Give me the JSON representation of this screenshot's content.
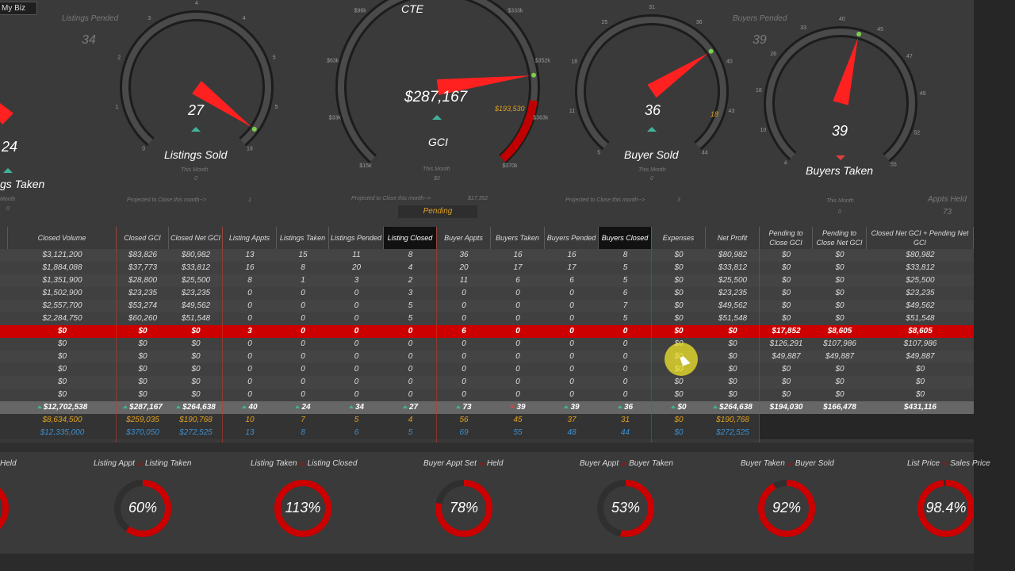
{
  "tab_label": "My Biz",
  "top_title": "CTE",
  "gauges": {
    "listings_taken": {
      "value": "24",
      "label": "gs Taken",
      "header_count": "34",
      "header_label": "Listings Pended",
      "ticks": [
        "5",
        "6",
        "7",
        "7",
        "7",
        "8"
      ]
    },
    "listings_sold": {
      "value": "27",
      "label": "Listings Sold",
      "sub": "This Month",
      "sub_val": "0",
      "proj_label": "Projected to Close this month-->",
      "proj_val": "1",
      "ticks": [
        "0",
        "1",
        "2",
        "3",
        "4",
        "4",
        "5",
        "5",
        "19"
      ]
    },
    "gci": {
      "value": "$287,167",
      "label": "GCI",
      "sub": "This Month",
      "sub_val": "$0",
      "proj_label": "Projected to Close this month-->",
      "proj_val": "$17,352",
      "target": "$193,530",
      "pending_btn": "Pending",
      "ticks": [
        "$15k",
        "$33k",
        "$63k",
        "$96k",
        "$259k",
        "$300k",
        "$333k",
        "$352k",
        "$363k",
        "$370k"
      ]
    },
    "buyer_sold": {
      "value": "36",
      "label": "Buyer Sold",
      "sub": "This Month",
      "sub_val": "0",
      "proj_label": "Projected to Close this month-->",
      "proj_val": "3",
      "target": "18",
      "ticks": [
        "5",
        "11",
        "18",
        "25",
        "31",
        "36",
        "40",
        "43",
        "44"
      ]
    },
    "buyers_taken": {
      "value": "39",
      "label": "Buyers Taken",
      "header_count": "39",
      "header_label": "Buyers Pended",
      "sub": "This Month",
      "sub_val": "0",
      "appts_label": "Appts Held",
      "appts_val": "73",
      "ticks": [
        "4",
        "10",
        "18",
        "26",
        "33",
        "40",
        "45",
        "47",
        "49",
        "52",
        "55"
      ]
    }
  },
  "table": {
    "headers": [
      "Closed Volume",
      "Closed GCI",
      "Closed Net GCI",
      "Listing Appts",
      "Listings Taken",
      "Listings Pended",
      "Listing Closed",
      "Buyer Appts",
      "Buyers Taken",
      "Buyers Pended",
      "Buyers Closed",
      "Expenses",
      "Net Profit",
      "Pending to Close GCI",
      "Pending to Close Net GCI",
      "Closed Net GCI + Pending Net GCI"
    ],
    "rows": [
      [
        "$3,121,200",
        "$83,826",
        "$80,982",
        "13",
        "15",
        "11",
        "8",
        "36",
        "16",
        "16",
        "8",
        "$0",
        "$80,982",
        "$0",
        "$0",
        "$80,982"
      ],
      [
        "$1,884,088",
        "$37,773",
        "$33,812",
        "16",
        "8",
        "20",
        "4",
        "20",
        "17",
        "17",
        "5",
        "$0",
        "$33,812",
        "$0",
        "$0",
        "$33,812"
      ],
      [
        "$1,351,900",
        "$28,800",
        "$25,500",
        "8",
        "1",
        "3",
        "2",
        "11",
        "6",
        "6",
        "5",
        "$0",
        "$25,500",
        "$0",
        "$0",
        "$25,500"
      ],
      [
        "$1,502,900",
        "$23,235",
        "$23,235",
        "0",
        "0",
        "0",
        "3",
        "0",
        "0",
        "0",
        "6",
        "$0",
        "$23,235",
        "$0",
        "$0",
        "$23,235"
      ],
      [
        "$2,557,700",
        "$53,274",
        "$49,562",
        "0",
        "0",
        "0",
        "5",
        "0",
        "0",
        "0",
        "7",
        "$0",
        "$49,562",
        "$0",
        "$0",
        "$49,562"
      ],
      [
        "$2,284,750",
        "$60,260",
        "$51,548",
        "0",
        "0",
        "0",
        "5",
        "0",
        "0",
        "0",
        "5",
        "$0",
        "$51,548",
        "$0",
        "$0",
        "$51,548"
      ],
      [
        "$0",
        "$0",
        "$0",
        "3",
        "0",
        "0",
        "0",
        "6",
        "0",
        "0",
        "0",
        "$0",
        "$0",
        "$17,852",
        "$8,605",
        "$8,605"
      ],
      [
        "$0",
        "$0",
        "$0",
        "0",
        "0",
        "0",
        "0",
        "0",
        "0",
        "0",
        "0",
        "$0",
        "$0",
        "$126,291",
        "$107,986",
        "$107,986"
      ],
      [
        "$0",
        "$0",
        "$0",
        "0",
        "0",
        "0",
        "0",
        "0",
        "0",
        "0",
        "0",
        "$0",
        "$0",
        "$49,887",
        "$49,887",
        "$49,887"
      ],
      [
        "$0",
        "$0",
        "$0",
        "0",
        "0",
        "0",
        "0",
        "0",
        "0",
        "0",
        "0",
        "$0",
        "$0",
        "$0",
        "$0",
        "$0"
      ],
      [
        "$0",
        "$0",
        "$0",
        "0",
        "0",
        "0",
        "0",
        "0",
        "0",
        "0",
        "0",
        "$0",
        "$0",
        "$0",
        "$0",
        "$0"
      ],
      [
        "$0",
        "$0",
        "$0",
        "0",
        "0",
        "0",
        "0",
        "0",
        "0",
        "0",
        "0",
        "$0",
        "$0",
        "$0",
        "$0",
        "$0"
      ]
    ],
    "total": [
      "$12,702,538",
      "$287,167",
      "$264,638",
      "40",
      "24",
      "34",
      "27",
      "73",
      "39",
      "39",
      "36",
      "$0",
      "$264,638",
      "$194,030",
      "$166,478",
      "$431,116"
    ],
    "goal": [
      "$8,634,500",
      "$259,035",
      "$190,768",
      "10",
      "7",
      "5",
      "4",
      "56",
      "45",
      "37",
      "31",
      "$0",
      "$190,768"
    ],
    "target": [
      "$12,335,000",
      "$370,050",
      "$272,525",
      "13",
      "8",
      "6",
      "5",
      "69",
      "55",
      "48",
      "44",
      "$0",
      "$272,525"
    ]
  },
  "donuts": [
    {
      "label_a": "Held",
      "label_b": "",
      "pct": ""
    },
    {
      "label_a": "Listing Appt",
      "label_b": "Listing Taken",
      "pct": "60%",
      "frac": 0.6
    },
    {
      "label_a": "Listing Taken",
      "label_b": "Listing Closed",
      "pct": "113%",
      "frac": 1.0
    },
    {
      "label_a": "Buyer  Appt Set",
      "label_b": "Held",
      "pct": "78%",
      "frac": 0.78
    },
    {
      "label_a": "Buyer Appt",
      "label_b": "Buyer Taken",
      "pct": "53%",
      "frac": 0.53
    },
    {
      "label_a": "Buyer Taken",
      "label_b": "Buyer Sold",
      "pct": "92%",
      "frac": 0.92
    },
    {
      "label_a": "List Price",
      "label_b": "Sales Price",
      "pct": "98.4%",
      "frac": 0.984
    }
  ],
  "colors": {
    "accent": "#cc0000",
    "teal": "#3fb39b",
    "gold": "#e0a020",
    "blue": "#3c8fd0"
  }
}
